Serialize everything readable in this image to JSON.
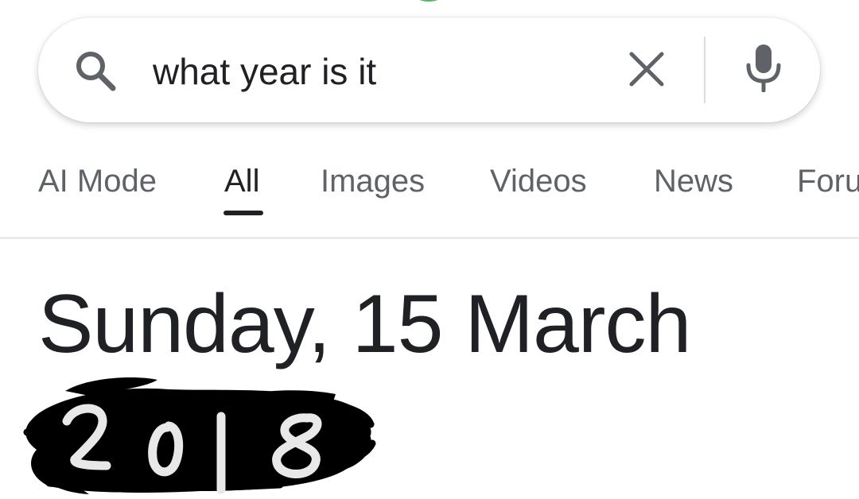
{
  "search": {
    "query": "what year is it"
  },
  "tabs": [
    {
      "label": "AI Mode",
      "active": false
    },
    {
      "label": "All",
      "active": true
    },
    {
      "label": "Images",
      "active": false
    },
    {
      "label": "Videos",
      "active": false
    },
    {
      "label": "News",
      "active": false
    },
    {
      "label": "Foru",
      "active": false
    }
  ],
  "result": {
    "date_line": "Sunday, 15 March",
    "year_handwritten": "2018"
  },
  "icons": {
    "search": "search-icon",
    "clear": "close-icon",
    "mic": "microphone-icon"
  },
  "colors": {
    "text_primary": "#202124",
    "text_secondary": "#5f6368",
    "accent_green": "#34a853",
    "scribble": "#000000",
    "handwriting": "#e8e8e8"
  }
}
